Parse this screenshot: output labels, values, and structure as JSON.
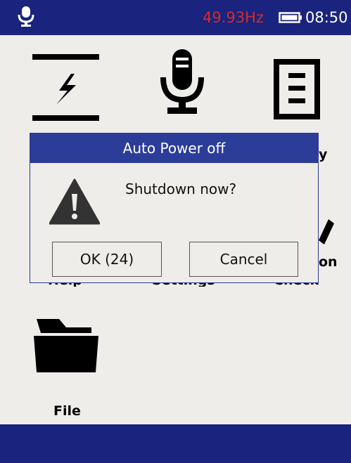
{
  "status_bar": {
    "mic_icon": "microphone-icon",
    "frequency": "49.93Hz",
    "battery_icon": "battery-icon",
    "clock": "08:50",
    "colors": {
      "background": "#1a237e",
      "frequency": "#d42b2b"
    }
  },
  "apps": [
    {
      "icon": "power-quality-icon",
      "label": "Help"
    },
    {
      "icon": "microphone-icon",
      "label": "Settings"
    },
    {
      "icon": "document-icon",
      "label": "Check"
    },
    {
      "icon": "folder-icon",
      "label": "File"
    }
  ],
  "hidden_label_fragments": {
    "app3_top": "y",
    "app3_middle": "on"
  },
  "dialog": {
    "title": "Auto Power off",
    "warning_icon": "warning-icon",
    "message": "Shutdown now?",
    "ok_label": "OK (24)",
    "cancel_label": "Cancel",
    "colors": {
      "title_bar": "#2c3d99"
    }
  },
  "bottom_bar": {
    "color": "#1a237e"
  }
}
